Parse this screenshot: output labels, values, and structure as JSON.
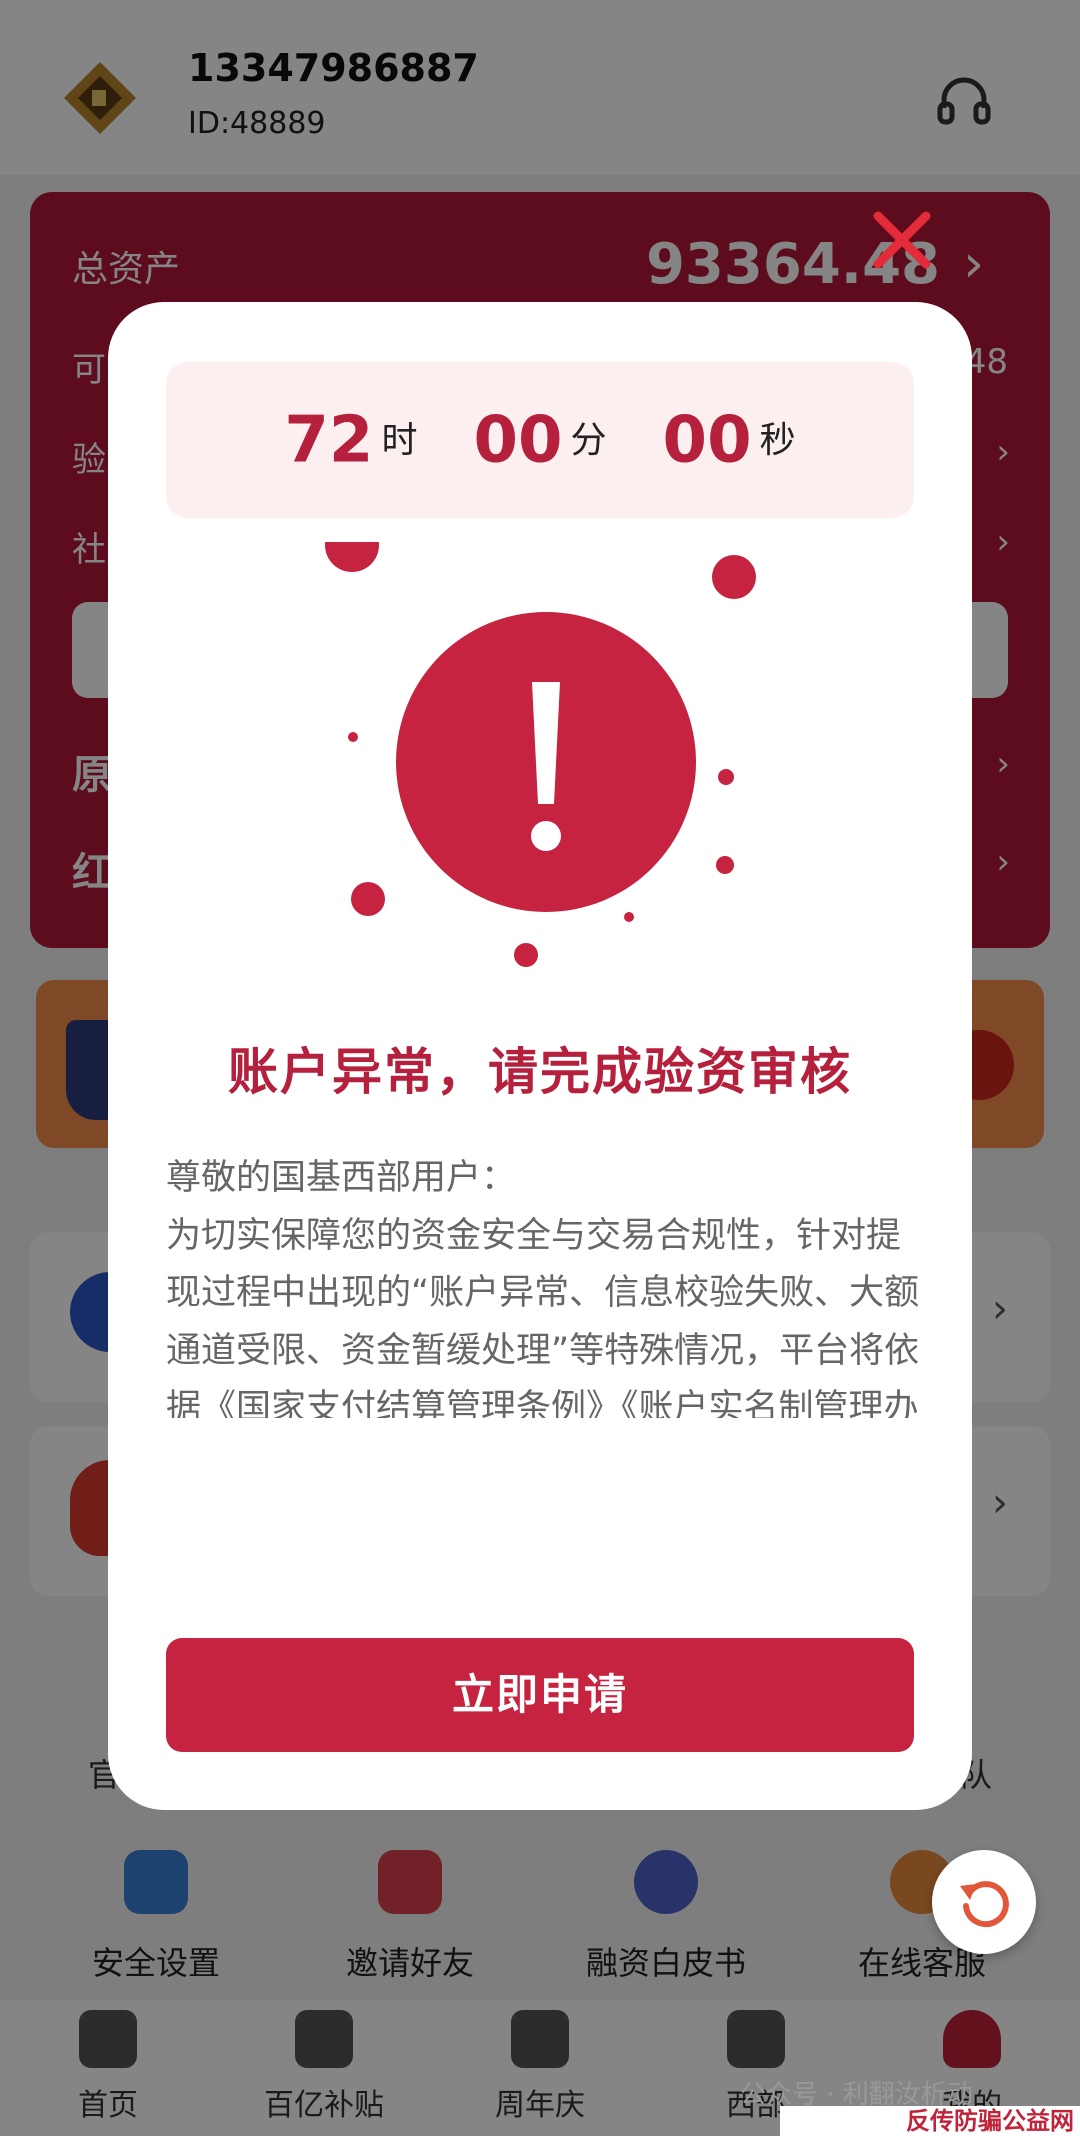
{
  "header": {
    "phone": "13347986887",
    "user_id": "ID:48889"
  },
  "asset_card": {
    "total_label": "总资产",
    "total_value": "93364.48",
    "rows": [
      {
        "label": "可",
        "right_text": "48"
      },
      {
        "label": "验"
      },
      {
        "label": "社"
      }
    ],
    "big_rows": [
      {
        "label": "原"
      },
      {
        "label": "红"
      }
    ]
  },
  "partial_strip": {
    "left": "官",
    "right": "队"
  },
  "shortcuts": [
    "安全设置",
    "邀请好友",
    "融资白皮书",
    "在线客服"
  ],
  "tabs": [
    "首页",
    "百亿补贴",
    "周年庆",
    "西部",
    "我的"
  ],
  "watermark": {
    "text": "公众号 · 利翻汝析动",
    "bar": "反传防骗公益网 www.wazi.cc"
  },
  "modal": {
    "countdown": {
      "hours": "72",
      "hours_unit": "时",
      "minutes": "00",
      "minutes_unit": "分",
      "seconds": "00",
      "seconds_unit": "秒"
    },
    "title": "账户异常，请完成验资审核",
    "body": [
      "尊敬的国基西部用户：",
      "为切实保障您的资金安全与交易合规性，针对提现过程中出现的“账户异常、信息校验失败、大额通道受限、资金暂缓处理”等特殊情况，平台将依据《国家支付结算管理条例》《账户实名制管理办法》《金融网络风控指引》等相关规定，启动专项验资审核流程，请您根据页面提示依次完成"
    ],
    "apply_label": "立即申请"
  },
  "colors": {
    "brand_red": "#b5213d",
    "button_red": "#c5233f",
    "countdown_bg": "#fbeff0"
  },
  "icons": [
    "logo-icon",
    "headset-icon",
    "close-icon",
    "exclamation-icon",
    "refresh-icon"
  ]
}
